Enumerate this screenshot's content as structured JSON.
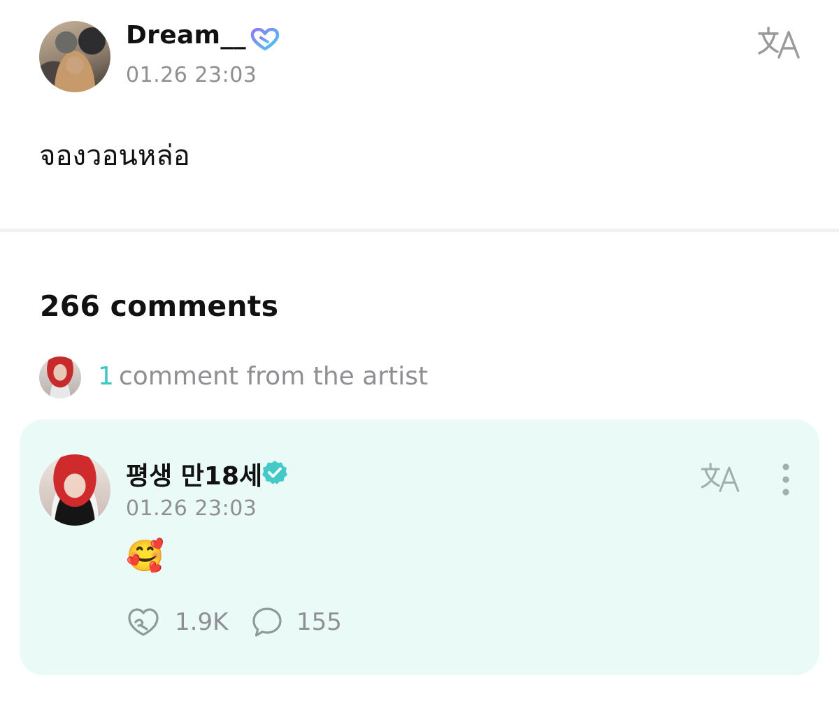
{
  "post": {
    "author": "Dream__",
    "timestamp": "01.26 23:03",
    "text": "จองวอนหล่อ",
    "badge_icon": "heart-badge-icon",
    "translate_icon": "translate-icon"
  },
  "comments": {
    "count_label": "266 comments",
    "artist_summary": {
      "count": "1",
      "label": "comment from the artist"
    },
    "items": [
      {
        "author": "평생 만18세",
        "timestamp": "01.26 23:03",
        "body": "🥰",
        "verified": true,
        "likes": "1.9K",
        "replies": "155"
      }
    ]
  },
  "colors": {
    "accent": "#3ec6c6",
    "card_background": "#eafaf7",
    "muted_text": "#8e8e93",
    "badge_gradient_start": "#8b7bf5",
    "badge_gradient_end": "#4cc6f2"
  }
}
